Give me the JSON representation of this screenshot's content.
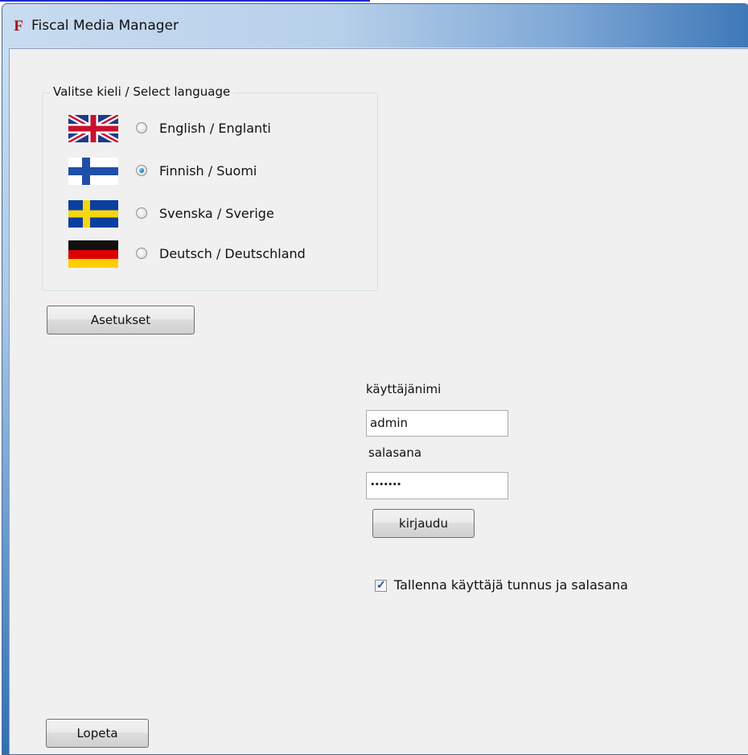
{
  "window": {
    "title": "Fiscal Media Manager",
    "app_icon_glyph": "F",
    "accent_color": "#2f6fb5"
  },
  "language_group": {
    "legend": "Valitse kieli / Select language",
    "options": [
      {
        "label": "English / Englanti",
        "flag": "uk-flag-icon",
        "selected": false
      },
      {
        "label": "Finnish / Suomi",
        "flag": "finland-flag-icon",
        "selected": true
      },
      {
        "label": "Svenska / Sverige",
        "flag": "sweden-flag-icon",
        "selected": false
      },
      {
        "label": "Deutsch / Deutschland",
        "flag": "germany-flag-icon",
        "selected": false
      }
    ]
  },
  "settings_button": {
    "label": "Asetukset"
  },
  "login": {
    "username_label": "käyttäjänimi",
    "username_value": "admin",
    "password_label": "salasana",
    "password_value": "•••••••",
    "login_button": "kirjaudu",
    "remember_label": "Tallenna käyttäjä tunnus ja salasana",
    "remember_checked": true
  },
  "exit_button": {
    "label": "Lopeta"
  }
}
